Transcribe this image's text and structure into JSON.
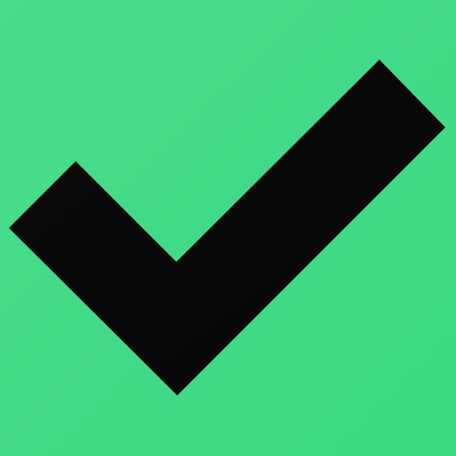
{
  "background": {
    "color_top_left": "#48dc8c",
    "color_bottom_right": "#3bd983"
  },
  "icon": {
    "name": "checkmark-icon",
    "fill_color": "#0b0b0b",
    "gradient_end_color": "#050505"
  }
}
